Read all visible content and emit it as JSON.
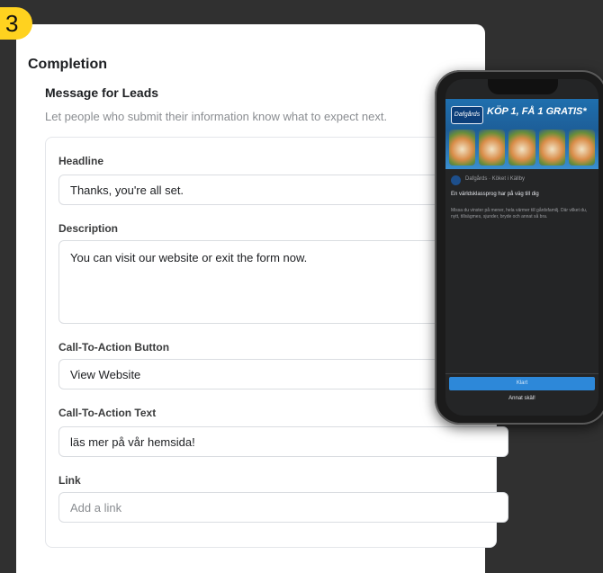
{
  "step": "3",
  "completion": {
    "title": "Completion",
    "message_title": "Message for Leads",
    "message_desc": "Let people who submit their information know what to expect next."
  },
  "fields": {
    "headline_label": "Headline",
    "headline_value": "Thanks, you're all set.",
    "description_label": "Description",
    "description_value": "You can visit our website or exit the form now.",
    "cta_button_label": "Call-To-Action Button",
    "cta_button_value": "View Website",
    "cta_text_label": "Call-To-Action Text",
    "cta_text_value": "läs mer på vår hemsida!",
    "link_label": "Link",
    "link_placeholder": "Add a link"
  },
  "preview": {
    "logo_text": "Dafgårds",
    "ad_headline": "KÖP 1, FÅ 1 GRATIS*",
    "page_name": "Dafgårds · Köket i Källby",
    "intro_title": "En världsklassprog har på väg till dig",
    "intro_desc": "Missa du vinster på mener, hela värmer till gårdsfamilj. Där vilket du, nytt, tillsägmes, sjunder, bryde och annat så bra.",
    "cta": "Klart",
    "secondary": "Annat skäl!"
  }
}
